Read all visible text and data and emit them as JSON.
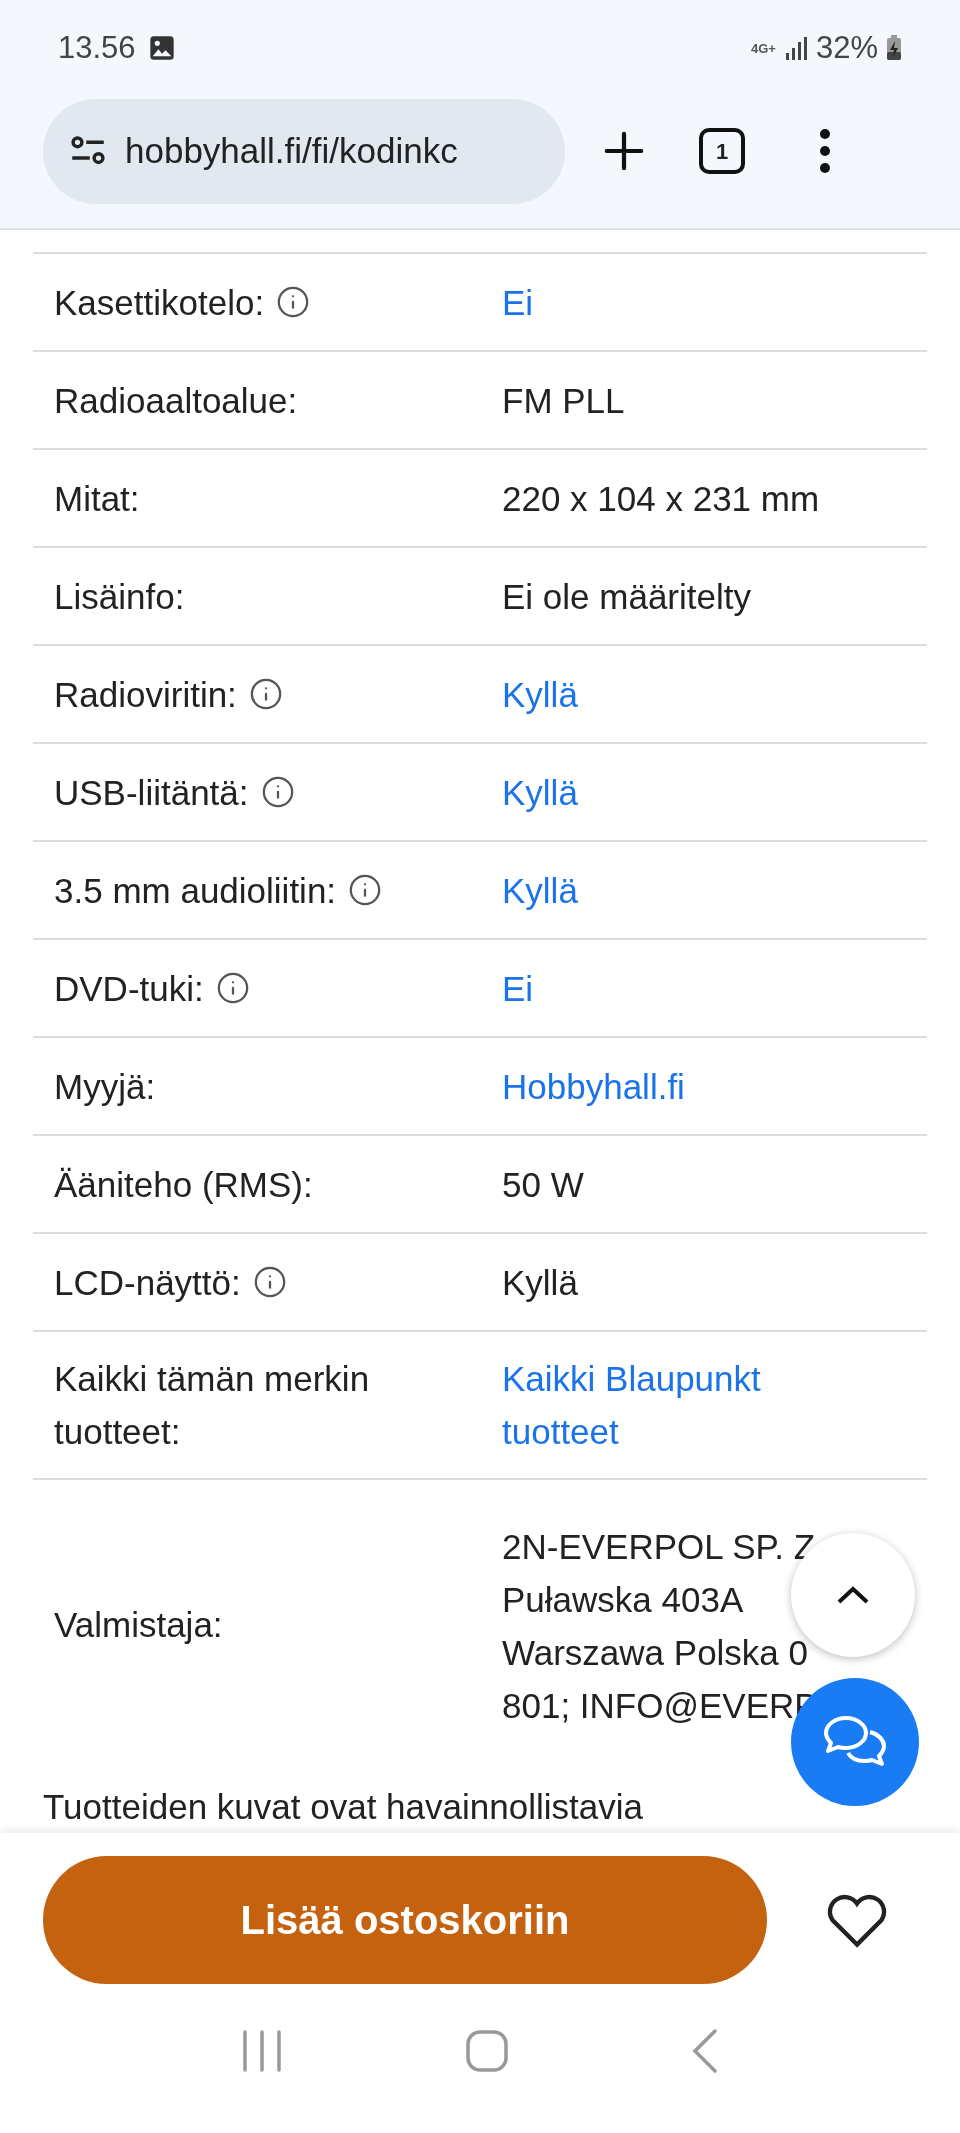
{
  "status_bar": {
    "time": "13.56",
    "network": "4G+",
    "battery": "32%"
  },
  "browser": {
    "url": "hobbyhall.fi/fi/kodinkc",
    "tab_count": "1"
  },
  "specs": [
    {
      "label": "Kasettikotelo:",
      "info": true,
      "value": "Ei",
      "link": true
    },
    {
      "label": "Radioaaltoalue:",
      "info": false,
      "value": "FM PLL",
      "link": false
    },
    {
      "label": "Mitat:",
      "info": false,
      "value": "220 x 104 x 231 mm",
      "link": false
    },
    {
      "label": "Lisäinfo:",
      "info": false,
      "value": "Ei ole määritelty",
      "link": false
    },
    {
      "label": "Radioviritin:",
      "info": true,
      "value": "Kyllä",
      "link": true
    },
    {
      "label": "USB-liitäntä:",
      "info": true,
      "value": "Kyllä",
      "link": true
    },
    {
      "label": "3.5 mm audioliitin:",
      "info": true,
      "value": "Kyllä",
      "link": true
    },
    {
      "label": "DVD-tuki:",
      "info": true,
      "value": "Ei",
      "link": true
    },
    {
      "label": "Myyjä:",
      "info": false,
      "value": "Hobbyhall.fi",
      "link": true
    },
    {
      "label": "Ääniteho (RMS):",
      "info": false,
      "value": "50 W",
      "link": false
    },
    {
      "label": "LCD-näyttö:",
      "info": true,
      "value": "Kyllä",
      "link": false
    },
    {
      "label": "Kaikki tämän merkin tuotteet:",
      "info": false,
      "value": "Kaikki Blaupunkt tuotteet",
      "link": true
    }
  ],
  "manufacturer": {
    "label": "Valmistaja:",
    "lines": [
      "2N-EVERPOL SP. Z",
      "Puławska 403A",
      "Warszawa Polska 0",
      "801; INFO@EVERP"
    ]
  },
  "disclaimer": "Tuotteiden kuvat ovat havainnollistavia",
  "cart_button": "Lisää ostoskoriin"
}
